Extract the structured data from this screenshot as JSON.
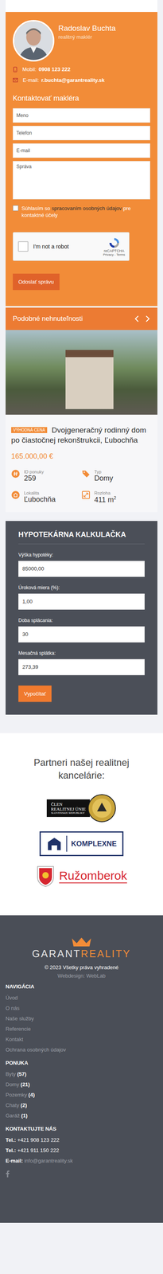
{
  "agent": {
    "name": "Radoslav Buchta",
    "role": "realitný maklér",
    "phone_label": "Mobil:",
    "phone": "0908 123 222",
    "email_label": "E-mail:",
    "email": "r.buchta@garantreality.sk"
  },
  "contact_form": {
    "title": "Kontaktovať makléra",
    "fields": [
      {
        "placeholder": "Meno",
        "kind": "input"
      },
      {
        "placeholder": "Telefon",
        "kind": "input"
      },
      {
        "placeholder": "E-mail",
        "kind": "input"
      },
      {
        "placeholder": "Správa",
        "kind": "textarea"
      }
    ],
    "consent": {
      "parts": [
        {
          "text": "Súhlasím so",
          "link": false
        },
        {
          "text": "spracovaním osobných údajov",
          "link": true
        },
        {
          "text": "pre kontaktné účely",
          "link": false
        }
      ],
      "checked": false
    },
    "captcha": {
      "label": "I'm not a robot",
      "brand": "reCAPTCHA",
      "links": "Privacy - Terms",
      "checked": false
    },
    "submit": "Odoslať správu"
  },
  "similar": {
    "title": "Podobné nehnuteľnosti",
    "listing": {
      "badge": "VÝHODNÁ CENA",
      "title": "Dvojgeneračný rodinný dom po čiastočnej rekonštrukcii, Ľubochňa",
      "price": "165.000,00 €",
      "details": [
        {
          "kind": "id",
          "label": "ID ponuky",
          "value": "259",
          "sup": ""
        },
        {
          "kind": "type",
          "label": "Typ",
          "value": "Domy",
          "sup": ""
        },
        {
          "kind": "location",
          "label": "Lokalita",
          "value": "Ľubochňa",
          "sup": ""
        },
        {
          "kind": "area",
          "label": "Rozloha",
          "value": "411 m",
          "sup": "2"
        }
      ]
    }
  },
  "calculator": {
    "title": "HYPOTEKÁRNA KALKULAČKA",
    "fields": [
      {
        "label": "Výška hypotéky:",
        "value": "85000,00"
      },
      {
        "label": "Úroková miera (%):",
        "value": "1,00"
      },
      {
        "label": "Doba splácania:",
        "value": "30"
      },
      {
        "label": "Mesačná splátka:",
        "value": "273,39"
      }
    ],
    "button": "Vypočítať"
  },
  "partners": {
    "title": "Partneri našej realitnej kancelárie:",
    "logos": [
      {
        "kind": "union",
        "lines": [
          "ČLEN",
          "REALITNEJ ÚNIE",
          "SLOVENSKEJ REPUBLIKY"
        ]
      },
      {
        "kind": "komplexne",
        "lines": [
          "KOMPLEXNE"
        ]
      },
      {
        "kind": "city",
        "lines": [
          "Ružomberok"
        ]
      }
    ]
  },
  "footer": {
    "brand": [
      "GARANT",
      "REALITY"
    ],
    "copyright": "© 2023 Všetky práva vyhradené",
    "credit": "Webdesign: WebLab",
    "navigation": {
      "title": "NAVIGÁCIA",
      "items": [
        "Úvod",
        "O nás",
        "Naše služby",
        "Referencie",
        "Kontakt",
        "Ochrana osobných údajov"
      ]
    },
    "offer": {
      "title": "PONUKA",
      "items": [
        {
          "label": "Byty",
          "count": "(57)"
        },
        {
          "label": "Domy",
          "count": "(21)"
        },
        {
          "label": "Pozemky",
          "count": "(4)"
        },
        {
          "label": "Chaty",
          "count": "(2)"
        },
        {
          "label": "Garáž",
          "count": "(1)"
        }
      ]
    },
    "contact": {
      "title": "KONTAKTUJTE NÁS",
      "lines": [
        {
          "label": "Tel.:",
          "value": "+421 908 123 222"
        },
        {
          "label": "Tel.:",
          "value": "+421 911 150 222"
        },
        {
          "label": "E-mail:",
          "value": "info@garantreality.sk"
        }
      ]
    }
  }
}
